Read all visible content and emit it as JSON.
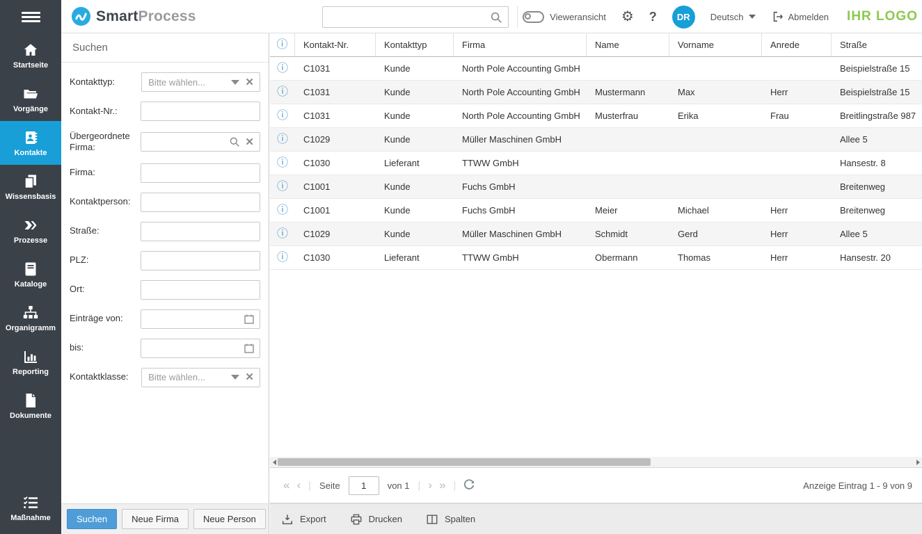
{
  "header": {
    "logo_smart": "Smart",
    "logo_process": "Process",
    "search_placeholder": "",
    "viewer_toggle_label": "Vieweransicht",
    "avatar_initials": "DR",
    "language": "Deutsch",
    "logout_label": "Abmelden",
    "brand_placeholder": "IHR LOGO"
  },
  "sidebar": {
    "items": [
      {
        "label": "Startseite",
        "icon": "home-icon",
        "active": false
      },
      {
        "label": "Vorgänge",
        "icon": "folder-icon",
        "active": false
      },
      {
        "label": "Kontakte",
        "icon": "contacts-icon",
        "active": true
      },
      {
        "label": "Wissensbasis",
        "icon": "pages-icon",
        "active": false
      },
      {
        "label": "Prozesse",
        "icon": "chevrons-icon",
        "active": false
      },
      {
        "label": "Kataloge",
        "icon": "book-icon",
        "active": false
      },
      {
        "label": "Organigramm",
        "icon": "orgchart-icon",
        "active": false
      },
      {
        "label": "Reporting",
        "icon": "barchart-icon",
        "active": false
      },
      {
        "label": "Dokumente",
        "icon": "document-icon",
        "active": false
      }
    ],
    "bottom_item": {
      "label": "Maßnahme",
      "icon": "checklist-icon"
    }
  },
  "search_panel": {
    "title": "Suchen",
    "fields": [
      {
        "label": "Kontakttyp:",
        "type": "select",
        "placeholder": "Bitte wählen..."
      },
      {
        "label": "Kontakt-Nr.:",
        "type": "text",
        "value": ""
      },
      {
        "label": "Übergeordnete Firma:",
        "type": "search",
        "value": ""
      },
      {
        "label": "Firma:",
        "type": "text",
        "value": ""
      },
      {
        "label": "Kontaktperson:",
        "type": "text",
        "value": ""
      },
      {
        "label": "Straße:",
        "type": "text",
        "value": ""
      },
      {
        "label": "PLZ:",
        "type": "text",
        "value": ""
      },
      {
        "label": "Ort:",
        "type": "text",
        "value": ""
      },
      {
        "label": "Einträge von:",
        "type": "date",
        "value": ""
      },
      {
        "label": "bis:",
        "type": "date",
        "value": ""
      },
      {
        "label": "Kontaktklasse:",
        "type": "select",
        "placeholder": "Bitte wählen..."
      }
    ],
    "buttons": {
      "search": "Suchen",
      "new_company": "Neue Firma",
      "new_person": "Neue Person"
    }
  },
  "table": {
    "columns": [
      "Kontakt-Nr.",
      "Kontakttyp",
      "Firma",
      "Name",
      "Vorname",
      "Anrede",
      "Straße"
    ],
    "rows": [
      {
        "nr": "C1031",
        "typ": "Kunde",
        "firma": "North Pole Accounting GmbH",
        "name": "",
        "vorname": "",
        "anrede": "",
        "strasse": "Beispielstraße 15"
      },
      {
        "nr": "C1031",
        "typ": "Kunde",
        "firma": "North Pole Accounting GmbH",
        "name": "Mustermann",
        "vorname": "Max",
        "anrede": "Herr",
        "strasse": "Beispielstraße 15"
      },
      {
        "nr": "C1031",
        "typ": "Kunde",
        "firma": "North Pole Accounting GmbH",
        "name": "Musterfrau",
        "vorname": "Erika",
        "anrede": "Frau",
        "strasse": "Breitlingstraße 987"
      },
      {
        "nr": "C1029",
        "typ": "Kunde",
        "firma": "Müller Maschinen GmbH",
        "name": "",
        "vorname": "",
        "anrede": "",
        "strasse": "Allee 5"
      },
      {
        "nr": "C1030",
        "typ": "Lieferant",
        "firma": "TTWW GmbH",
        "name": "",
        "vorname": "",
        "anrede": "",
        "strasse": "Hansestr. 8"
      },
      {
        "nr": "C1001",
        "typ": "Kunde",
        "firma": "Fuchs GmbH",
        "name": "",
        "vorname": "",
        "anrede": "",
        "strasse": "Breitenweg"
      },
      {
        "nr": "C1001",
        "typ": "Kunde",
        "firma": "Fuchs GmbH",
        "name": "Meier",
        "vorname": "Michael",
        "anrede": "Herr",
        "strasse": "Breitenweg"
      },
      {
        "nr": "C1029",
        "typ": "Kunde",
        "firma": "Müller Maschinen GmbH",
        "name": "Schmidt",
        "vorname": "Gerd",
        "anrede": "Herr",
        "strasse": "Allee 5"
      },
      {
        "nr": "C1030",
        "typ": "Lieferant",
        "firma": "TTWW GmbH",
        "name": "Obermann",
        "vorname": "Thomas",
        "anrede": "Herr",
        "strasse": "Hansestr. 20"
      }
    ]
  },
  "pagination": {
    "page_label": "Seite",
    "page_value": "1",
    "of_label": "von 1",
    "status": "Anzeige Eintrag 1 - 9 von 9"
  },
  "toolbar": {
    "export": "Export",
    "print": "Drucken",
    "columns": "Spalten"
  },
  "colors": {
    "sidebar_dark": "#3a4149",
    "accent_blue": "#189fd7",
    "button_blue": "#4e9dd8",
    "brand_green": "#8cc94f",
    "row_alt": "#f5f5f5"
  }
}
